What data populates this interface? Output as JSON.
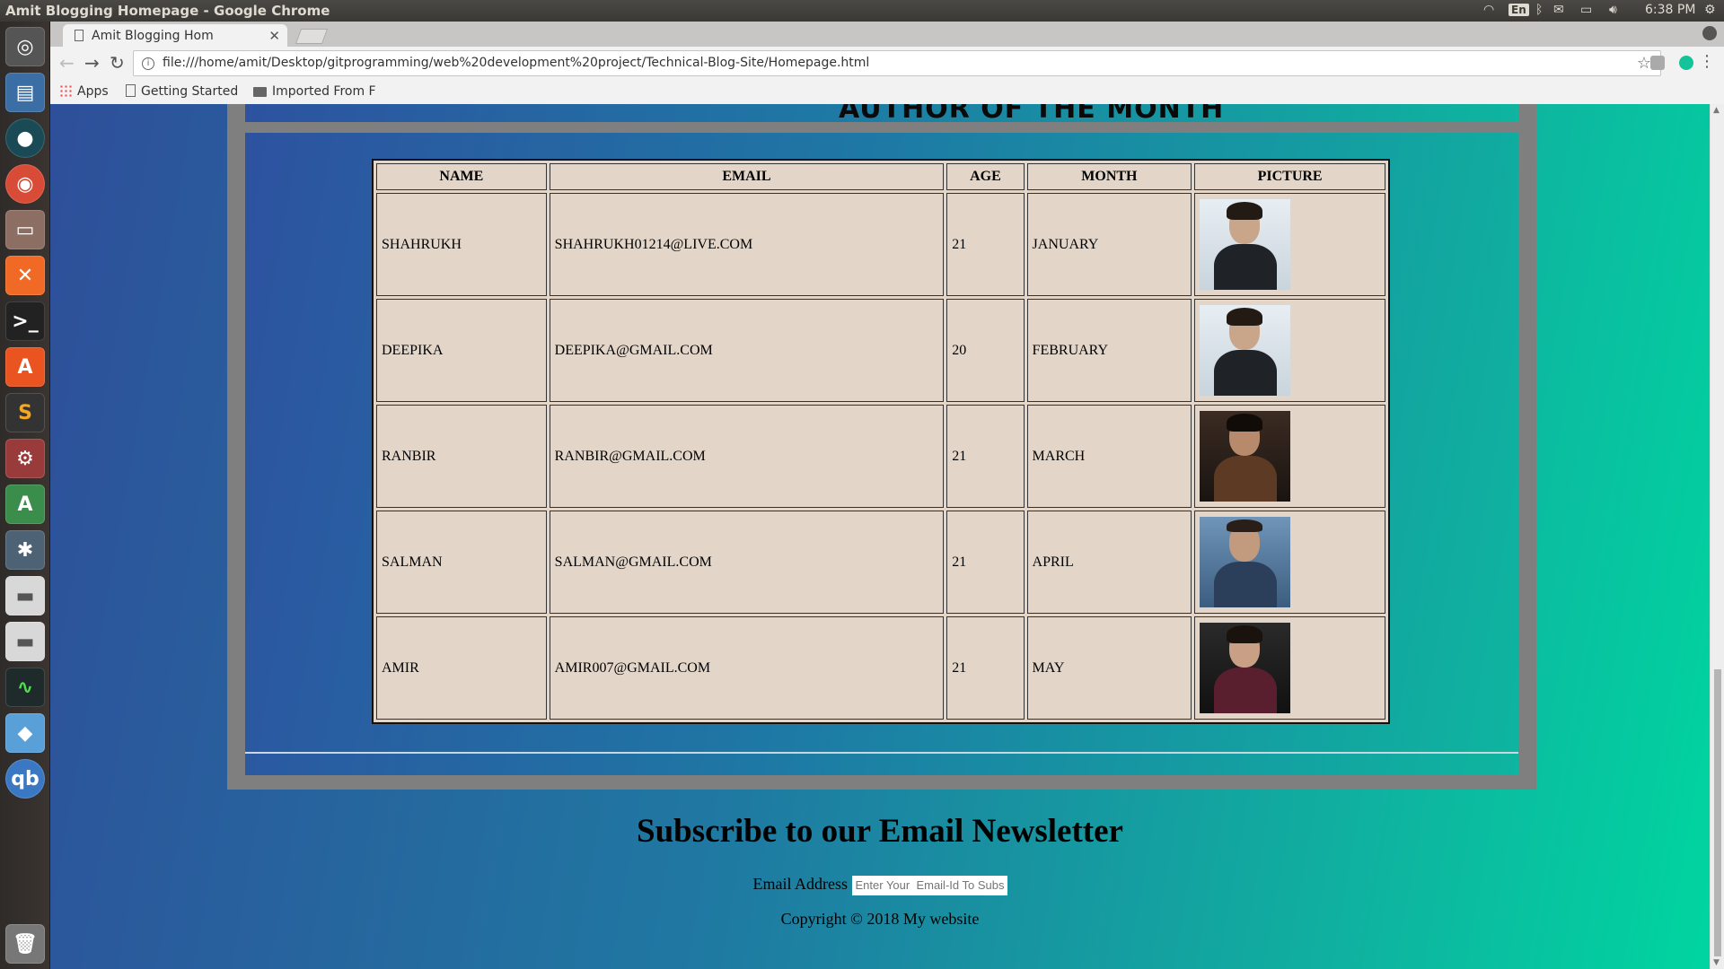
{
  "os": {
    "window_title": "Amit Blogging Homepage - Google Chrome",
    "keyboard_layout": "En",
    "clock": "6:38 PM"
  },
  "browser": {
    "tab_title": "Amit Blogging Hom",
    "url": "file:///home/amit/Desktop/gitprogramming/web%20development%20project/Technical-Blog-Site/Homepage.html",
    "bookmarks": [
      "Apps",
      "Getting Started",
      "Imported From F"
    ]
  },
  "page": {
    "author_heading": "AUTHOR OF THE MONTH",
    "table": {
      "headers": [
        "NAME",
        "EMAIL",
        "AGE",
        "MONTH",
        "PICTURE"
      ],
      "rows": [
        {
          "name": "SHAHRUKH",
          "email": "SHAHRUKH01214@LIVE.COM",
          "age": "21",
          "month": "JANUARY"
        },
        {
          "name": "DEEPIKA",
          "email": "DEEPIKA@GMAIL.COM",
          "age": "20",
          "month": "FEBRUARY"
        },
        {
          "name": "RANBIR",
          "email": "RANBIR@GMAIL.COM",
          "age": "21",
          "month": "MARCH"
        },
        {
          "name": "SALMAN",
          "email": "SALMAN@GMAIL.COM",
          "age": "21",
          "month": "APRIL"
        },
        {
          "name": "AMIR",
          "email": "AMIR007@GMAIL.COM",
          "age": "21",
          "month": "MAY"
        }
      ]
    },
    "newsletter": {
      "title": "Subscribe to our Email Newsletter",
      "label": "Email Address",
      "placeholder": "Enter Your  Email-Id To Subscribe"
    },
    "copyright": "Copyright © 2018 My website"
  },
  "colors": {
    "launcher": "#2e2b29",
    "table_bg": "#e3d6c9",
    "panel_border": "#7f7f7f",
    "gradient_left": "#2e4f9a",
    "gradient_right": "#00d5a0"
  }
}
